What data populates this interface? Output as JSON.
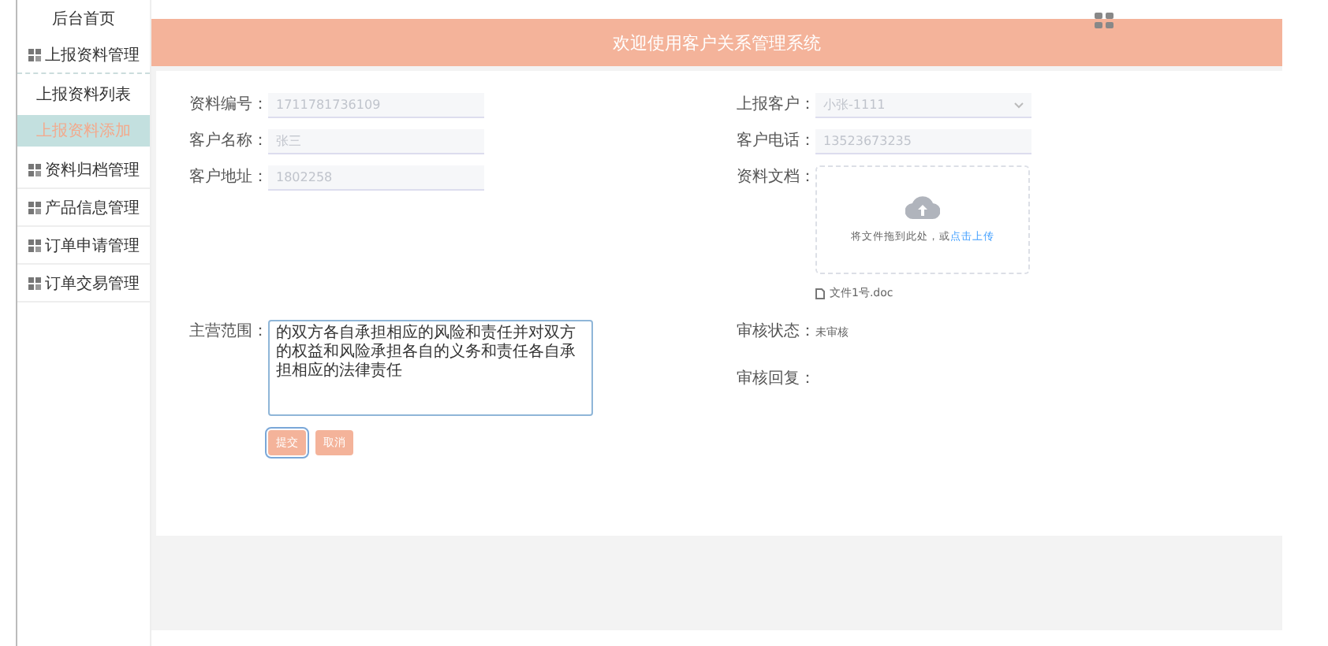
{
  "header": {
    "title": "欢迎使用客户关系管理系统"
  },
  "sidebar": {
    "items": [
      {
        "label": "后台首页",
        "kind": "plain",
        "selected": false
      },
      {
        "label": "上报资料管理",
        "kind": "group",
        "selected": false,
        "children": [
          {
            "label": "上报资料列表",
            "selected": false
          },
          {
            "label": "上报资料添加",
            "selected": true
          }
        ]
      },
      {
        "label": "资料归档管理",
        "kind": "group",
        "selected": false
      },
      {
        "label": "产品信息管理",
        "kind": "group",
        "selected": false
      },
      {
        "label": "订单申请管理",
        "kind": "group",
        "selected": false
      },
      {
        "label": "订单交易管理",
        "kind": "group",
        "selected": false
      }
    ]
  },
  "form": {
    "left_fields": [
      {
        "label": "资料编号：",
        "value": "1711781736109",
        "disabled": true
      },
      {
        "label": "客户名称：",
        "value": "张三",
        "disabled": true
      },
      {
        "label": "客户地址：",
        "value": "1802258",
        "disabled": true
      }
    ],
    "customer": {
      "label": "上报客户：",
      "value": "小张-1111",
      "disabled": true
    },
    "phone": {
      "label": "客户电话：",
      "value": "13523673235",
      "disabled": true
    },
    "document": {
      "label": "资料文档：",
      "upload_text": "将文件拖到此处，或",
      "upload_link": "点击上传",
      "file": "文件1号.doc"
    },
    "business_scope": {
      "label": "主营范围：",
      "value": "的双方各自承担相应的风险和责任并对双方的权益和风险承担各自的义务和责任各自承担相应的法律责任"
    },
    "review_status": {
      "label": "审核状态：",
      "value": "未审核"
    },
    "review_reply": {
      "label": "审核回复："
    },
    "buttons": [
      {
        "label": "提交",
        "focused": true
      },
      {
        "label": "取消",
        "focused": false
      }
    ]
  }
}
